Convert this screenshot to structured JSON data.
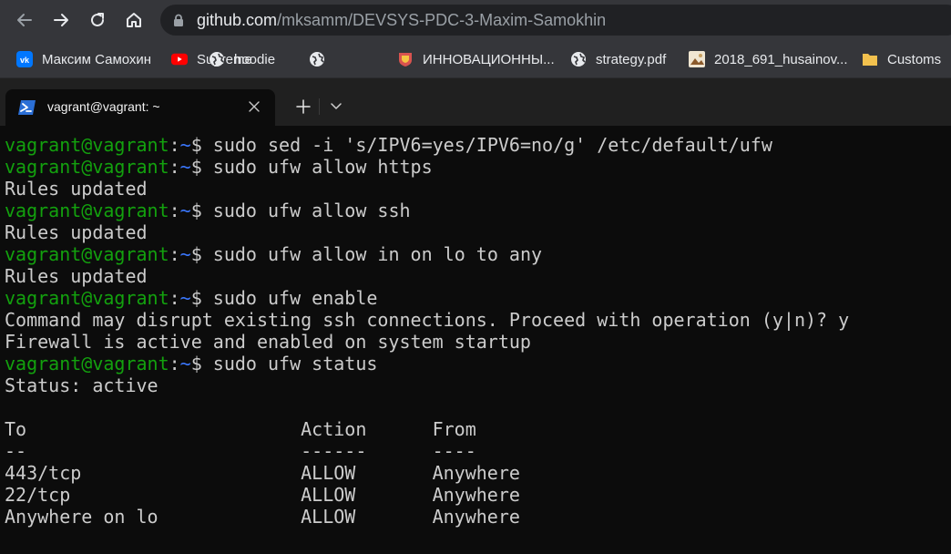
{
  "browser": {
    "url_host": "github.com",
    "url_path": "/mksamm/DEVSYS-PDC-3-Maxim-Samokhin",
    "nav": {
      "back_icon": "arrow-left-icon",
      "forward_icon": "arrow-right-icon",
      "reload_icon": "reload-icon",
      "home_icon": "home-icon"
    }
  },
  "bookmarks": [
    {
      "label": "Максим Самохин",
      "icon": "vk-icon",
      "color": "#0077ff"
    },
    {
      "label": "Supreme",
      "icon": "youtube-icon",
      "color": "#ff0000"
    },
    {
      "label": "hoodie",
      "icon": "globe-icon",
      "color": "#e8eaed"
    },
    {
      "label": "ИННОВАЦИОННЫ...",
      "icon": "globe-icon",
      "color": "#e8eaed"
    },
    {
      "label": "strategy.pdf",
      "icon": "crest-icon",
      "color": "#d9534f"
    },
    {
      "label": "2018_691_husainov...",
      "icon": "globe-icon",
      "color": "#e8eaed"
    },
    {
      "label": "Customs",
      "icon": "image-icon",
      "color": "#c8a060"
    },
    {
      "label": "",
      "icon": "folder-icon",
      "color": "#f2c14e"
    }
  ],
  "terminal": {
    "tab_title": "vagrant@vagrant: ~",
    "prompt_user": "vagrant@vagrant",
    "prompt_sep": ":",
    "prompt_path": "~",
    "lines": [
      {
        "type": "cmd",
        "text": "$ sudo sed -i 's/IPV6=yes/IPV6=no/g' /etc/default/ufw"
      },
      {
        "type": "cmd",
        "text": "$ sudo ufw allow https"
      },
      {
        "type": "out",
        "text": "Rules updated"
      },
      {
        "type": "cmd",
        "text": "$ sudo ufw allow ssh"
      },
      {
        "type": "out",
        "text": "Rules updated"
      },
      {
        "type": "cmd",
        "text": "$ sudo ufw allow in on lo to any"
      },
      {
        "type": "out",
        "text": "Rules updated"
      },
      {
        "type": "cmd",
        "text": "$ sudo ufw enable"
      },
      {
        "type": "out",
        "text": "Command may disrupt existing ssh connections. Proceed with operation (y|n)? y"
      },
      {
        "type": "out",
        "text": "Firewall is active and enabled on system startup"
      },
      {
        "type": "cmd",
        "text": "$ sudo ufw status"
      },
      {
        "type": "out",
        "text": "Status: active"
      },
      {
        "type": "out",
        "text": ""
      },
      {
        "type": "out",
        "text": "To                         Action      From"
      },
      {
        "type": "out",
        "text": "--                         ------      ----"
      },
      {
        "type": "out",
        "text": "443/tcp                    ALLOW       Anywhere"
      },
      {
        "type": "out",
        "text": "22/tcp                     ALLOW       Anywhere"
      },
      {
        "type": "out",
        "text": "Anywhere on lo             ALLOW       Anywhere"
      }
    ]
  },
  "colors": {
    "prompt_user": "#13a10e",
    "prompt_path": "#3b78ff",
    "terminal_text": "#cccccc",
    "terminal_bg": "#0c0c0c"
  }
}
